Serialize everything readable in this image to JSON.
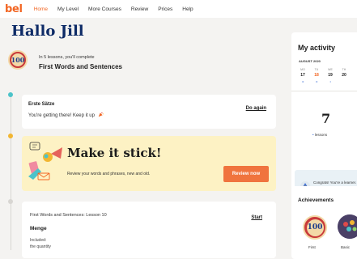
{
  "nav": {
    "logo": "bel",
    "links": [
      "Home",
      "My Level",
      "More Courses",
      "Review",
      "Prices",
      "Help"
    ]
  },
  "greeting": "Hallo Jill",
  "course": {
    "badge": "100",
    "subtitle": "In 5 lessons, you'll complete",
    "title": "First Words and Sentences"
  },
  "card_recent": {
    "title": "Erste Sätze",
    "message": "You're getting there! Keep it up",
    "action": "Do again"
  },
  "card_review": {
    "title": "Make it stick!",
    "description": "Review your words and phrases, new and old.",
    "button": "Review now"
  },
  "card_next": {
    "subtitle": "First Words and Sentences: Lesson 10",
    "title": "Menge",
    "included": "Included:",
    "first_item": "the quantity",
    "action": "Start"
  },
  "activity": {
    "title": "My activity",
    "month": "AUGUST 2020",
    "days": [
      {
        "name": "MO",
        "date": "17",
        "dots": "••"
      },
      {
        "name": "TU",
        "date": "18",
        "dots": "••"
      },
      {
        "name": "WE",
        "date": "19",
        "dots": "•"
      },
      {
        "name": "TH",
        "date": "20",
        "dots": ""
      }
    ],
    "lessons_count": "7",
    "lessons_label": "lessons",
    "congrats": "Congrats! You're a learner. Stay ac..."
  },
  "achievements": {
    "title": "Achievements",
    "badge1_text": "100",
    "badge1_label": "First",
    "badge2_label": "Basic"
  },
  "colors": {
    "brand": "#f26522",
    "heading": "#0d2a66",
    "review_bg": "#fdf2c4",
    "review_button": "#f0743e",
    "accent_blue": "#3b6fd6"
  }
}
